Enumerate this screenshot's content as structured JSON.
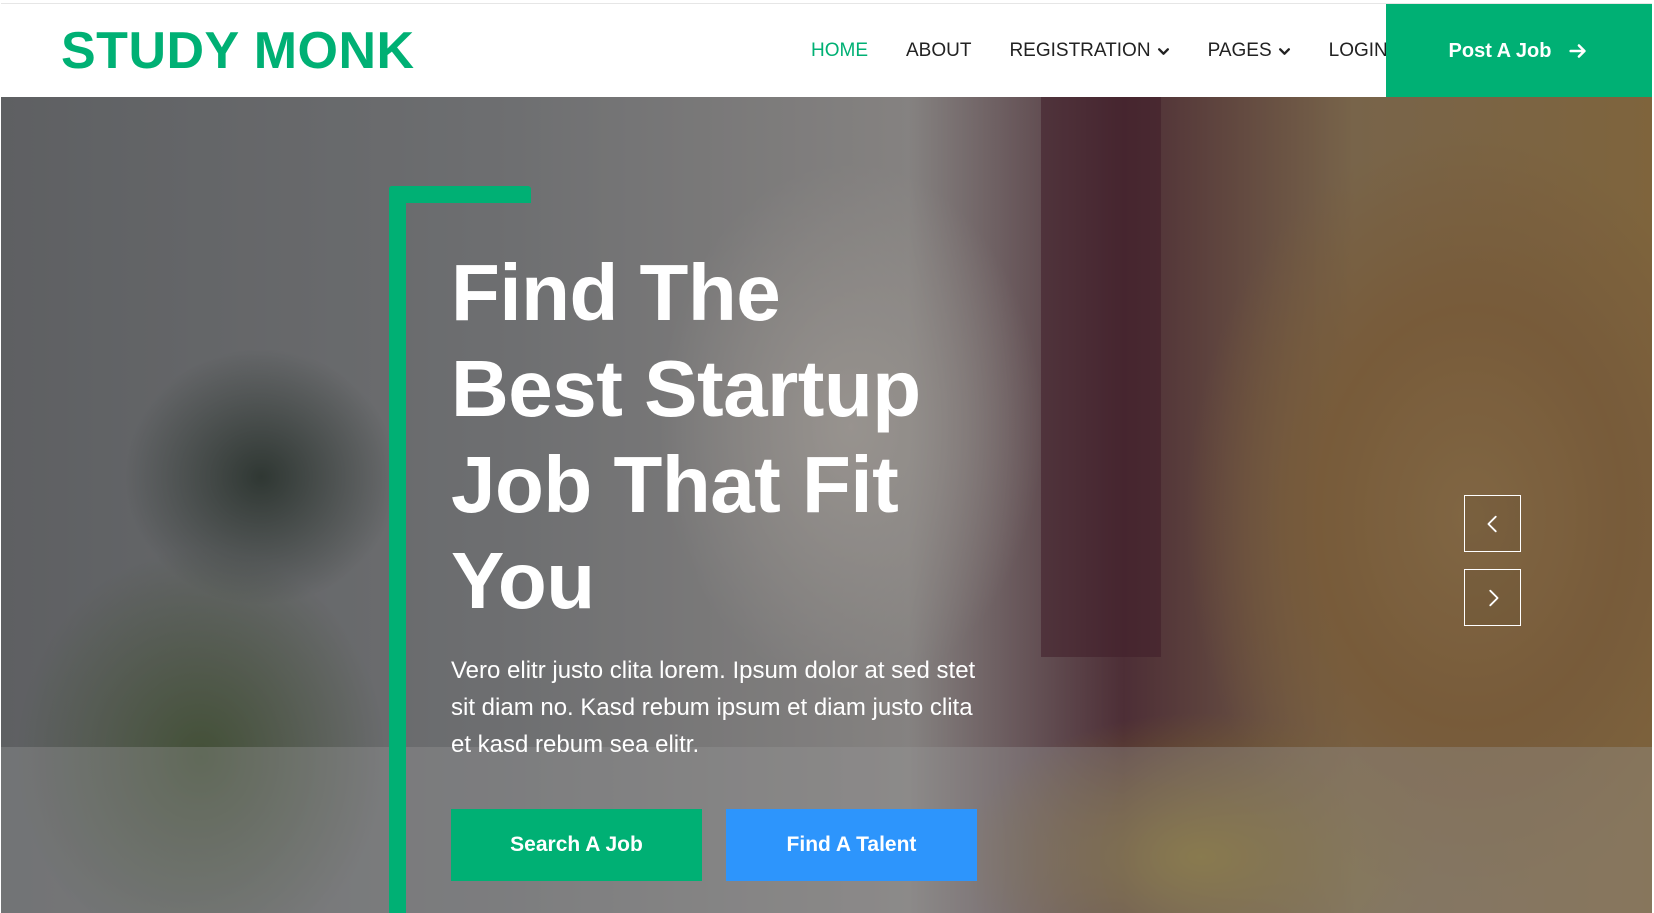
{
  "navbar": {
    "brand": "STUDY MONK",
    "items": [
      {
        "label": "HOME",
        "active": true,
        "dropdown": false
      },
      {
        "label": "ABOUT",
        "active": false,
        "dropdown": false
      },
      {
        "label": "REGISTRATION",
        "active": false,
        "dropdown": true
      },
      {
        "label": "PAGES",
        "active": false,
        "dropdown": true
      },
      {
        "label": "LOGIN",
        "active": false,
        "dropdown": false
      }
    ],
    "cta_label": "Post A Job",
    "cta_icon": "arrow-right-icon"
  },
  "hero": {
    "title_lines": [
      "Find The",
      "Best Startup",
      "Job That Fit",
      "You"
    ],
    "description": "Vero elitr justo clita lorem. Ipsum dolor at sed stet sit diam no. Kasd rebum ipsum et diam justo clita et kasd rebum sea elitr.",
    "primary_button": "Search A Job",
    "secondary_button": "Find A Talent",
    "carousel_prev_icon": "chevron-left-icon",
    "carousel_next_icon": "chevron-right-icon"
  },
  "colors": {
    "brand": "#00b074",
    "secondary": "#2d95fc",
    "nav_text": "#222222",
    "white": "#ffffff"
  }
}
